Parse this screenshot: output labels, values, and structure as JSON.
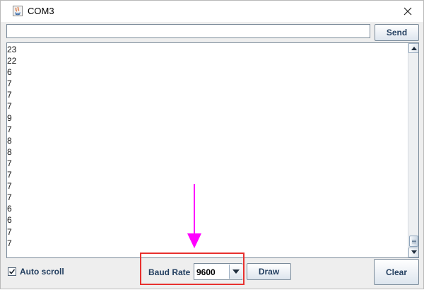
{
  "window": {
    "title": "COM3",
    "icon": "java-app-icon"
  },
  "send": {
    "input_value": "",
    "button_label": "Send"
  },
  "output": {
    "lines": [
      "23",
      "22",
      "6",
      "7",
      "7",
      "7",
      "9",
      "7",
      "8",
      "8",
      "7",
      "7",
      "7",
      "7",
      "6",
      "6",
      "7",
      "7"
    ]
  },
  "footer": {
    "autoscroll_label": "Auto scroll",
    "autoscroll_checked": true,
    "baud_label": "Baud Rate",
    "baud_value": "9600",
    "draw_label": "Draw",
    "clear_label": "Clear"
  },
  "annotation": {
    "arrow_color": "#ff00ff",
    "box_color": "#e8312f"
  }
}
